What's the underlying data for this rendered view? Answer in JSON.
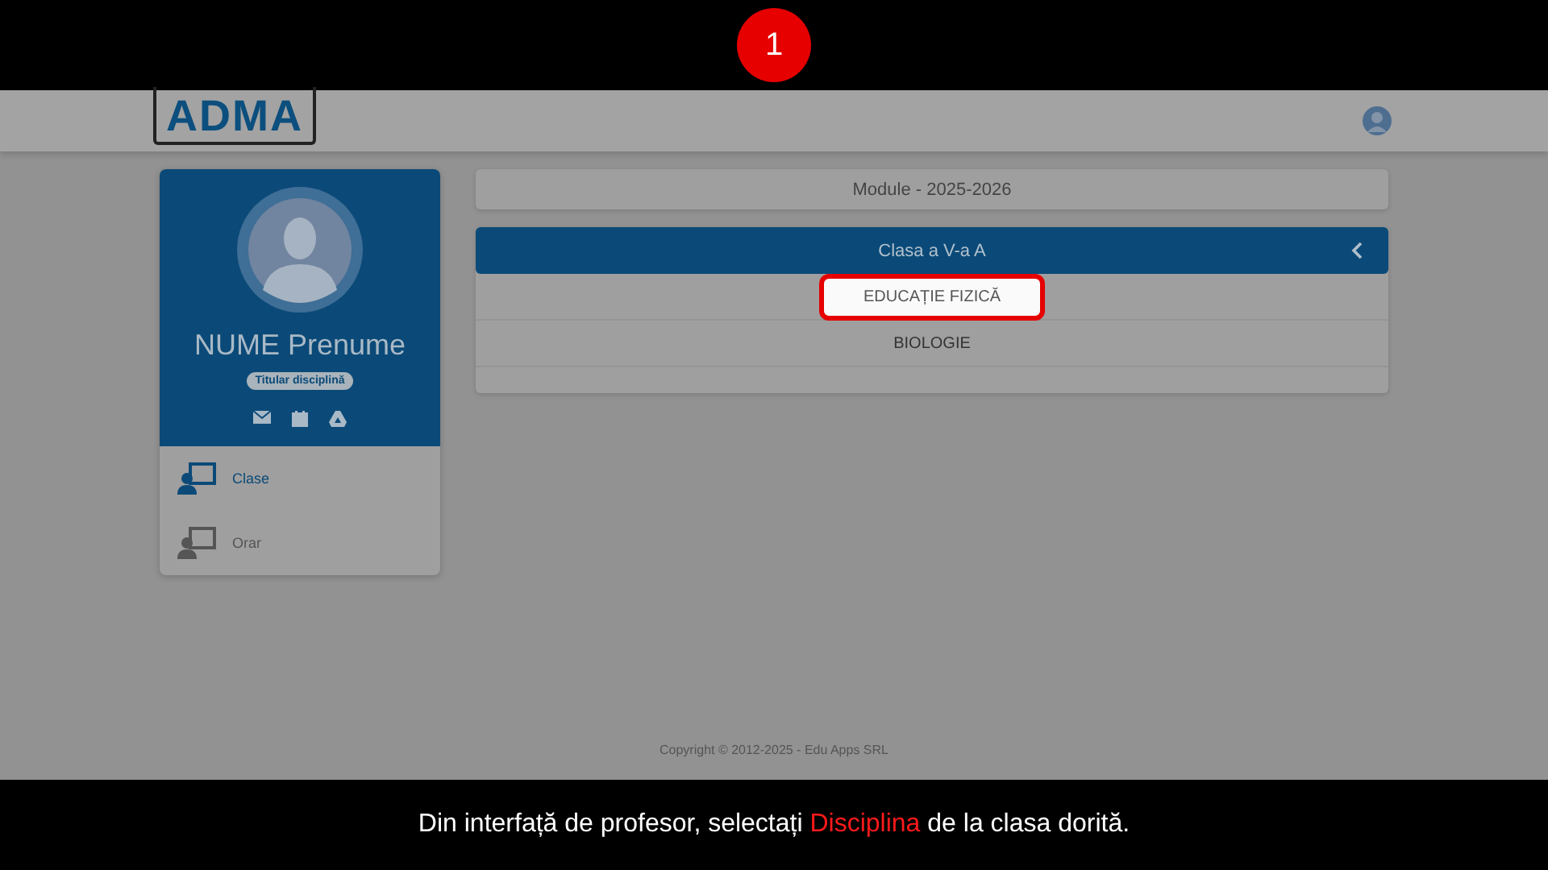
{
  "step": {
    "number": "1"
  },
  "header": {
    "logo": "ADMA"
  },
  "profile": {
    "name": "NUME Prenume",
    "role": "Titular disciplină"
  },
  "sidebar": {
    "items": [
      {
        "label": "Clase",
        "selected": true
      },
      {
        "label": "Orar",
        "selected": false
      }
    ]
  },
  "modules": {
    "title": "Module - 2025-2026"
  },
  "class_group": {
    "title": "Clasa a V-a A",
    "expanded": true,
    "subjects": [
      {
        "label": "EDUCAȚIE FIZICĂ",
        "highlighted": true
      },
      {
        "label": "BIOLOGIE",
        "highlighted": false
      }
    ]
  },
  "footer": {
    "copyright": "Copyright © 2012-2025 - Edu Apps SRL"
  },
  "caption": {
    "before": "Din interfață de profesor, selectați",
    "highlight": "Disciplina",
    "after": "de la clasa dorită."
  }
}
